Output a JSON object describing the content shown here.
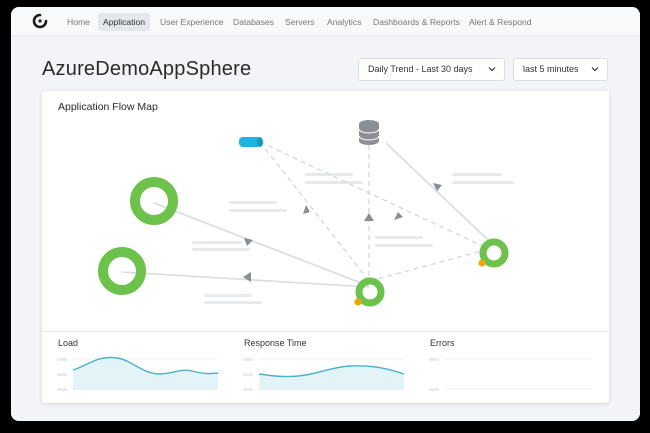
{
  "nav": {
    "items": [
      {
        "label": "Home",
        "active": false
      },
      {
        "label": "Application",
        "active": true
      },
      {
        "label": "User Experience",
        "active": false
      },
      {
        "label": "Databases",
        "active": false
      },
      {
        "label": "Servers",
        "active": false
      },
      {
        "label": "Analytics",
        "active": false
      },
      {
        "label": "Dashboards & Reports",
        "active": false
      },
      {
        "label": "Alert & Respond",
        "active": false
      }
    ]
  },
  "header": {
    "title": "AzureDemoAppSphere",
    "trend_dropdown": "Daily Trend - Last 30 days",
    "range_dropdown": "last 5 minutes"
  },
  "flow_map": {
    "title": "Application Flow Map",
    "nodes": [
      {
        "name": "queue-icon",
        "kind": "queue"
      },
      {
        "name": "database-icon",
        "kind": "database"
      },
      {
        "name": "tier-node-1",
        "kind": "tier"
      },
      {
        "name": "tier-node-2",
        "kind": "tier"
      },
      {
        "name": "tier-node-3",
        "kind": "tier"
      },
      {
        "name": "tier-node-4",
        "kind": "tier"
      }
    ]
  },
  "metrics": [
    {
      "label": "Load"
    },
    {
      "label": "Response Time"
    },
    {
      "label": "Errors"
    }
  ],
  "colors": {
    "node_green": "#6cc24a",
    "warning_orange": "#f0a30a",
    "queue_blue": "#1fb3e0",
    "database_gray": "#8c8f94",
    "sparkline_line": "#4ab3cf",
    "sparkline_fill": "#e3f4f9"
  }
}
